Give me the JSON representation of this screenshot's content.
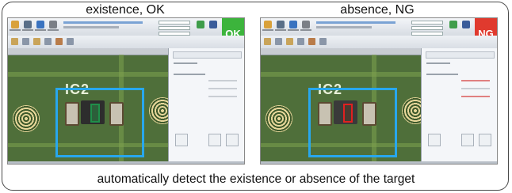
{
  "panels": [
    {
      "title": "existence, OK",
      "status": "OK",
      "status_color": "#3cb43c",
      "target_color": "#1f8f4a"
    },
    {
      "title": "absence, NG",
      "status": "NG",
      "status_color": "#e03a2e",
      "target_color": "#e02020"
    }
  ],
  "caption": "automatically detect the existence or absence of the target",
  "icons": [
    "open-file-icon",
    "camera-icon",
    "save-icon",
    "settings-icon",
    "run-icon",
    "stop-icon"
  ],
  "colors": {
    "roi": "#28a7ee",
    "pcb": "#4f6f3a"
  }
}
